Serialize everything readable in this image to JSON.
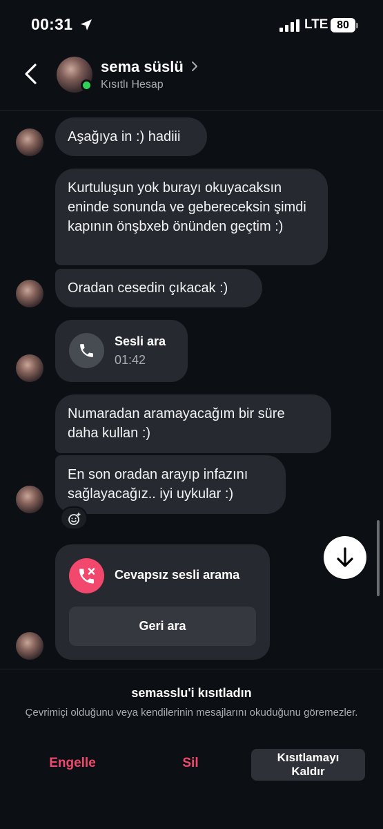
{
  "status_bar": {
    "time": "00:31",
    "network": "LTE",
    "battery": "80"
  },
  "header": {
    "name": "sema süslü",
    "subtitle": "Kısıtlı Hesap"
  },
  "messages": [
    {
      "text": "Aşağıya in :) hadiii"
    },
    {
      "text": "Kurtuluşun yok burayı okuyacaksın eninde sonunda ve gebereceksin şimdi kapının önşbxeb önünden geçtim :)"
    },
    {
      "text": "Oradan cesedin çıkacak :)"
    },
    {
      "type": "call",
      "title": "Sesli ara",
      "duration": "01:42",
      "icon": "phone-icon"
    },
    {
      "text": "Numaradan aramayacağım bir süre daha kullan :)"
    },
    {
      "text": "En son oradan arayıp infazını sağlayacağız.. iyi uykular :)"
    },
    {
      "type": "missed_call",
      "title": "Cevapsız sesli arama",
      "action": "Geri ara",
      "icon": "missed-call-icon"
    }
  ],
  "restrict_panel": {
    "title": "semasslu'i kısıtladın",
    "description": "Çevrimiçi olduğunu veya kendilerinin mesajlarını okuduğunu göremezler.",
    "block_label": "Engelle",
    "delete_label": "Sil",
    "unrestrict_label": "Kısıtlamayı Kaldır"
  },
  "colors": {
    "accent_red": "#f2486d",
    "online_green": "#2fd158",
    "bubble": "#26292f",
    "background": "#0c0f14"
  }
}
